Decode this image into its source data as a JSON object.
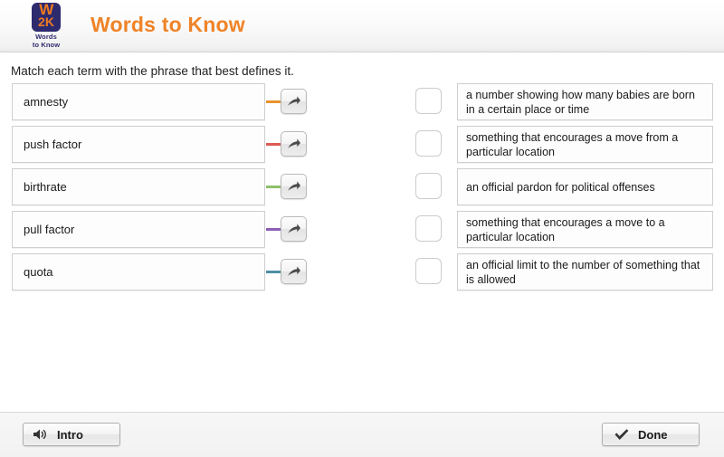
{
  "header": {
    "title": "Words to Know",
    "logo": {
      "mark_line1": "W",
      "mark_line2": "2K",
      "caption_line1": "Words",
      "caption_line2": "to Know"
    }
  },
  "instruction": "Match each term with the phrase that best defines it.",
  "match": {
    "terms": [
      {
        "label": "amnesty",
        "connector_color": "#e8942e"
      },
      {
        "label": "push factor",
        "connector_color": "#dd5a52"
      },
      {
        "label": "birthrate",
        "connector_color": "#8dc06a"
      },
      {
        "label": "pull factor",
        "connector_color": "#8e5fb5"
      },
      {
        "label": "quota",
        "connector_color": "#4d8fa6"
      }
    ],
    "definitions": [
      {
        "text": "a number showing how many babies are born in a certain place or time"
      },
      {
        "text": "something that encourages a move from a particular location"
      },
      {
        "text": "an official pardon for political offenses"
      },
      {
        "text": "something that encourages a move to a particular location"
      },
      {
        "text": "an official limit to the number of something that is allowed"
      }
    ]
  },
  "footer": {
    "intro_label": "Intro",
    "done_label": "Done"
  },
  "colors": {
    "brand_orange": "#ef8327",
    "brand_navy": "#2d2a6e"
  }
}
